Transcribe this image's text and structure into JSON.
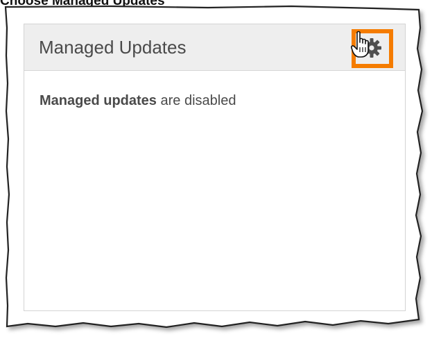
{
  "caption": {
    "text": "Choose Managed Updates"
  },
  "panel": {
    "title": "Managed Updates",
    "settings_icon": "gear-icon",
    "status_strong": "Managed updates",
    "status_rest": "are disabled"
  },
  "cursor": {
    "icon": "hand-cursor-icon"
  },
  "colors": {
    "highlight": "#f57c00",
    "header_bg": "#eeeeee",
    "border": "#d3d3d3",
    "text": "#4a4a4a"
  }
}
